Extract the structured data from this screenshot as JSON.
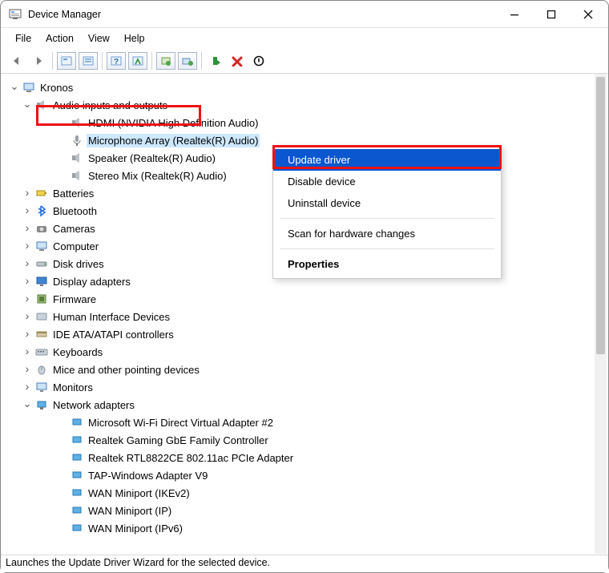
{
  "window": {
    "title": "Device Manager"
  },
  "menu": {
    "file": "File",
    "action": "Action",
    "view": "View",
    "help": "Help"
  },
  "tree": {
    "root": "Kronos",
    "audio": {
      "label": "Audio inputs and outputs",
      "items": [
        "HDMI (NVIDIA High Definition Audio)",
        "Microphone Array (Realtek(R) Audio)",
        "Speaker (Realtek(R) Audio)",
        "Stereo Mix (Realtek(R) Audio)"
      ]
    },
    "categories": [
      "Batteries",
      "Bluetooth",
      "Cameras",
      "Computer",
      "Disk drives",
      "Display adapters",
      "Firmware",
      "Human Interface Devices",
      "IDE ATA/ATAPI controllers",
      "Keyboards",
      "Mice and other pointing devices",
      "Monitors"
    ],
    "network": {
      "label": "Network adapters",
      "items": [
        "Microsoft Wi-Fi Direct Virtual Adapter #2",
        "Realtek Gaming GbE Family Controller",
        "Realtek RTL8822CE 802.11ac PCIe Adapter",
        "TAP-Windows Adapter V9",
        "WAN Miniport (IKEv2)",
        "WAN Miniport (IP)",
        "WAN Miniport (IPv6)"
      ]
    }
  },
  "contextMenu": {
    "updateDriver": "Update driver",
    "disableDevice": "Disable device",
    "uninstallDevice": "Uninstall device",
    "scan": "Scan for hardware changes",
    "properties": "Properties"
  },
  "status": "Launches the Update Driver Wizard for the selected device."
}
